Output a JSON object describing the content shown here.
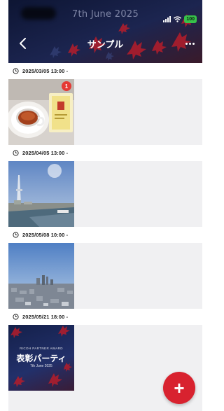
{
  "status_bar": {
    "date": "7th June 2025",
    "battery": "100"
  },
  "nav": {
    "title": "サンプル"
  },
  "sections": [
    {
      "datetime": "2025/03/05 13:00 -",
      "badge": "1"
    },
    {
      "datetime": "2025/04/05 13:00 -"
    },
    {
      "datetime": "2025/05/08 10:00 -"
    },
    {
      "datetime": "2025/05/21 18:00 -"
    }
  ],
  "award_thumb": {
    "subtitle": "RICOH PARTNER AWARD",
    "title": "表彰パーティ",
    "date": "7th June 2025"
  },
  "colors": {
    "accent_red": "#d8222f",
    "header_navy": "#1c2550",
    "badge_red": "#e53935"
  },
  "icons": [
    "back-icon",
    "more-icon",
    "clock-icon",
    "plus-icon",
    "signal-icon",
    "wifi-icon",
    "battery-icon"
  ]
}
